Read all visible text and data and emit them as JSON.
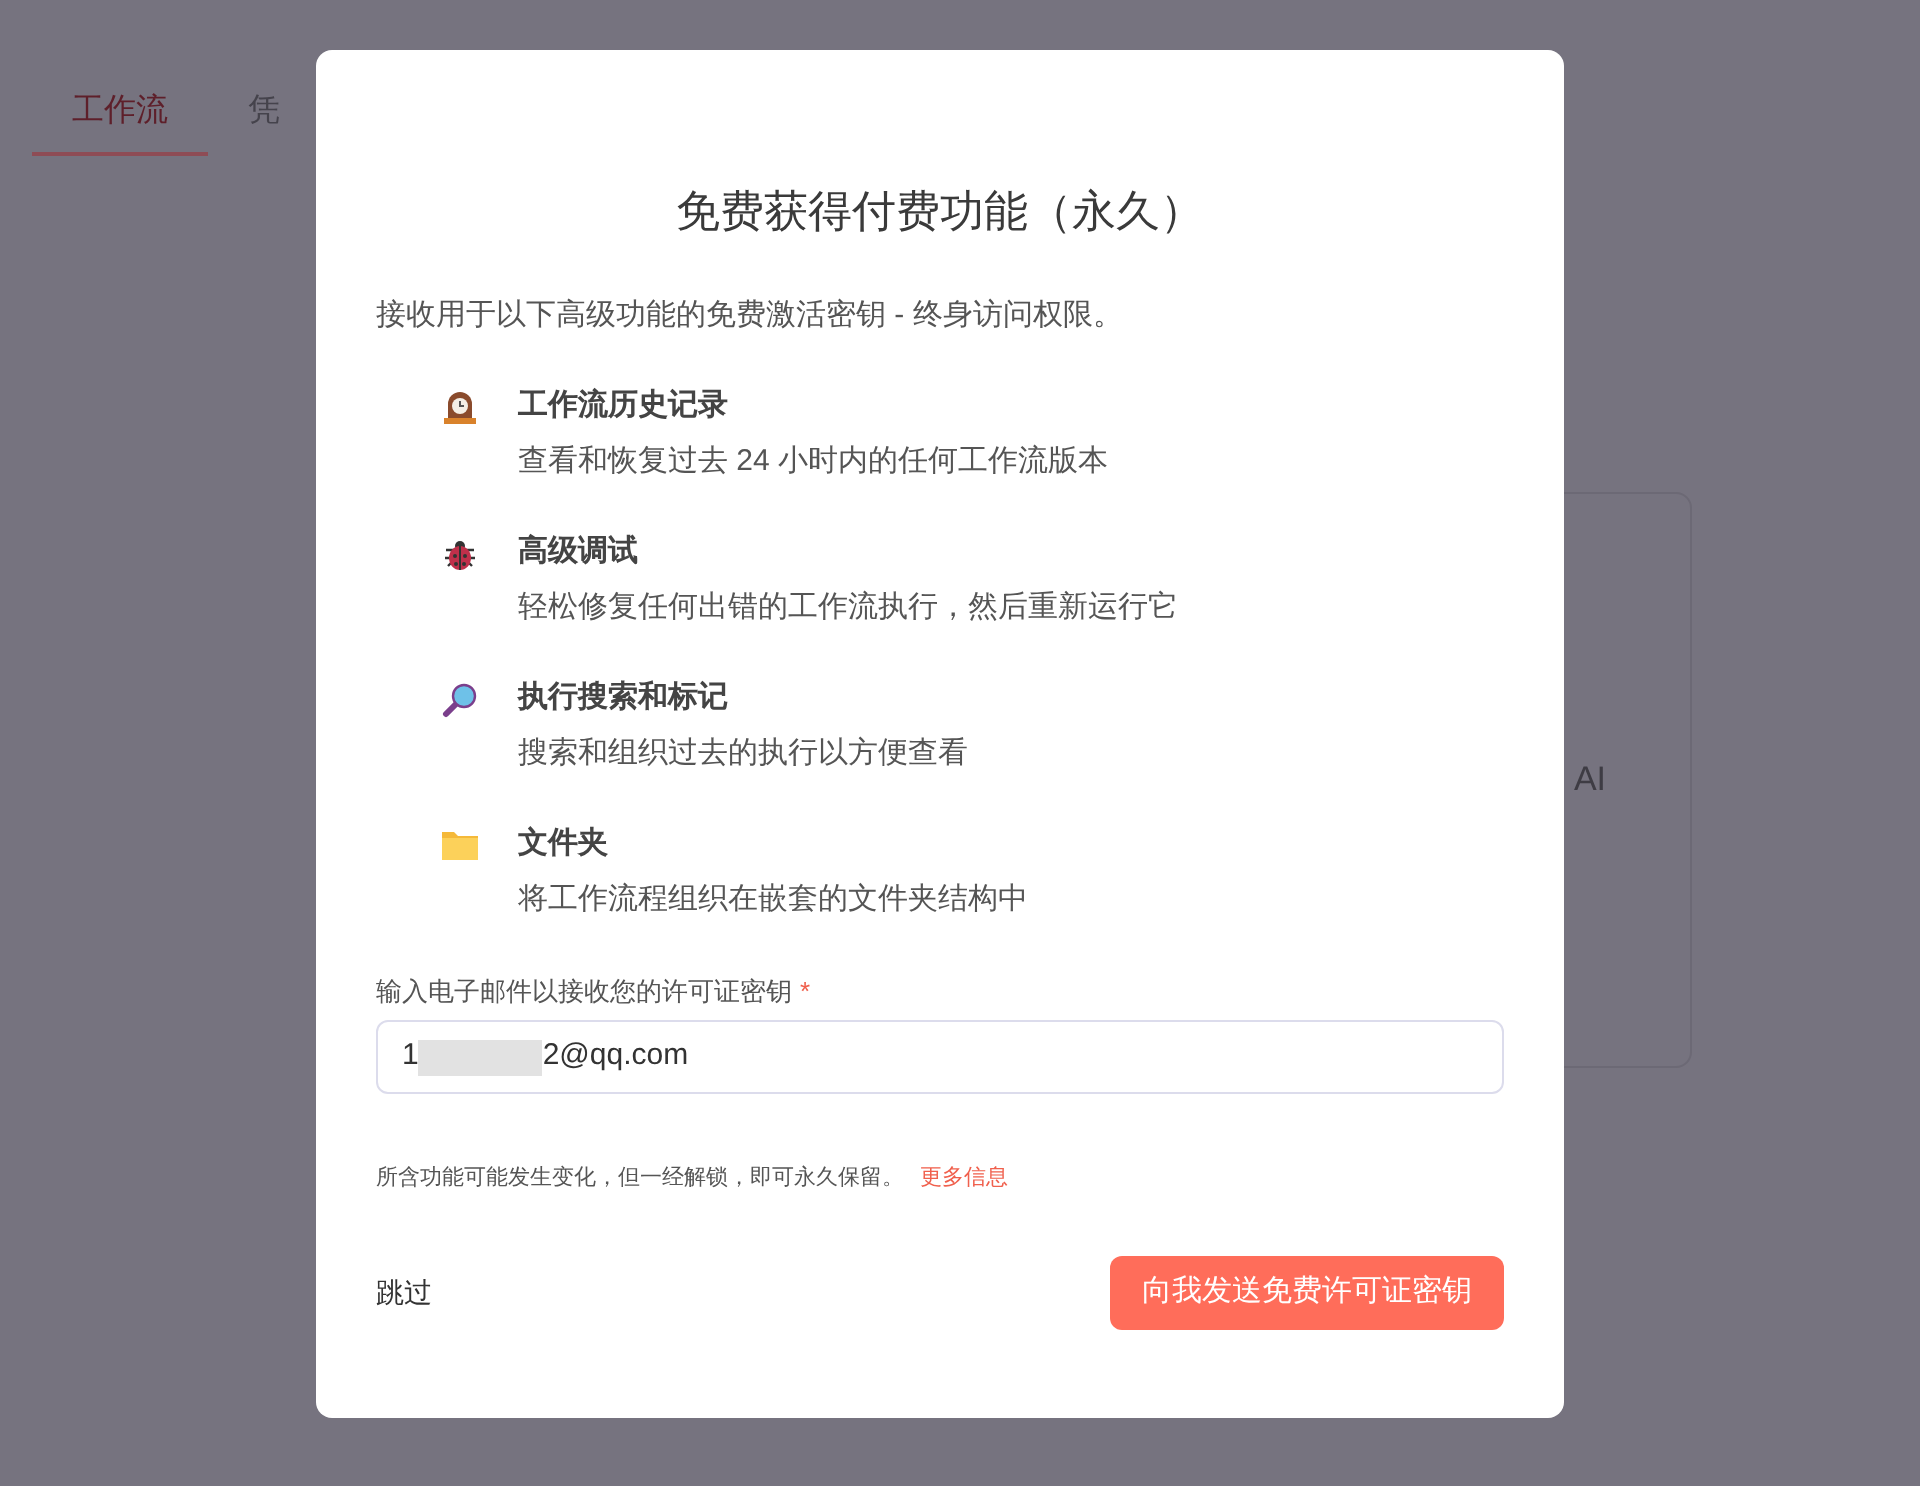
{
  "background": {
    "tabs": [
      {
        "label": "工作流",
        "selected": true
      },
      {
        "label": "凭",
        "selected": false
      }
    ],
    "card": {
      "text": "AI"
    }
  },
  "modal": {
    "title": "免费获得付费功能（永久）",
    "intro": "接收用于以下高级功能的免费激活密钥 - 终身访问权限。",
    "features": [
      {
        "kind": "clock",
        "title": "工作流历史记录",
        "description": "查看和恢复过去 24 小时内的任何工作流版本"
      },
      {
        "kind": "bug",
        "title": "高级调试",
        "description": "轻松修复任何出错的工作流执行，然后重新运行它"
      },
      {
        "kind": "search",
        "title": "执行搜索和标记",
        "description": "搜索和组织过去的执行以方便查看"
      },
      {
        "kind": "folder",
        "title": "文件夹",
        "description": "将工作流程组织在嵌套的文件夹结构中"
      }
    ],
    "email": {
      "label": "输入电子邮件以接收您的许可证密钥",
      "required_mark": "*",
      "value_start": "1",
      "value_end": "2@qq.com"
    },
    "note": "所含功能可能发生变化，但一经解锁，即可永久保留。",
    "more_link": "更多信息",
    "skip": "跳过",
    "submit": "向我发送免费许可证密钥"
  }
}
